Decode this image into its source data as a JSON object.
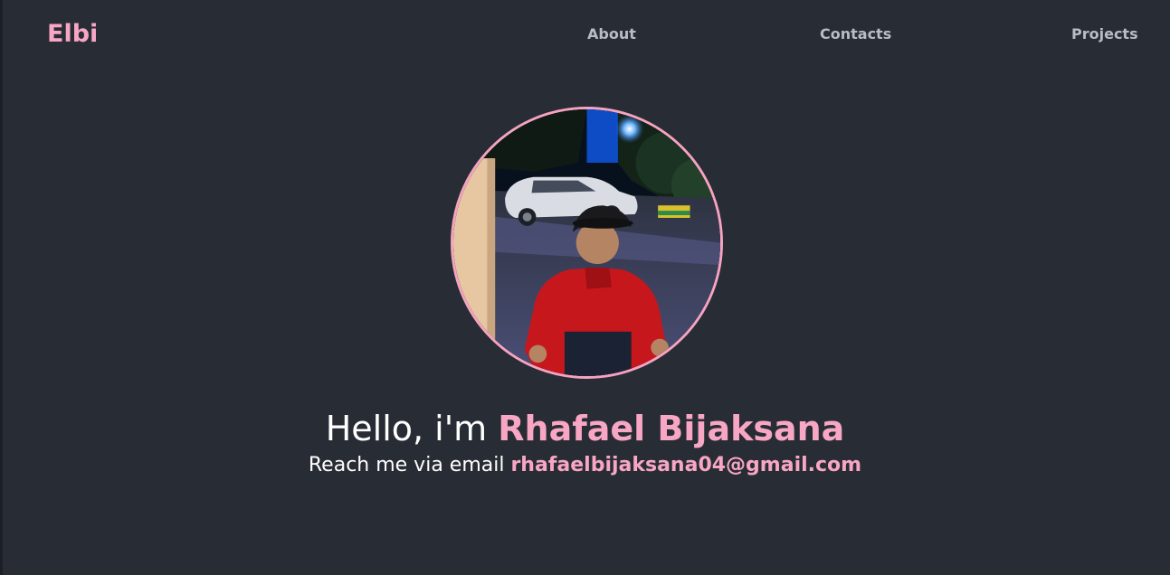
{
  "nav": {
    "brand": "Elbi",
    "links": [
      {
        "label": "About"
      },
      {
        "label": "Contacts"
      },
      {
        "label": "Projects"
      }
    ]
  },
  "hero": {
    "greeting": "Hello, i'm ",
    "name": "Rhafael Bijaksana",
    "contact_prefix": "Reach me via email ",
    "email": "rhafaelbijaksana04@gmail.com"
  },
  "colors": {
    "background": "#282c34",
    "accent": "#f7a6c3",
    "nav_text": "#b7bcc5"
  }
}
